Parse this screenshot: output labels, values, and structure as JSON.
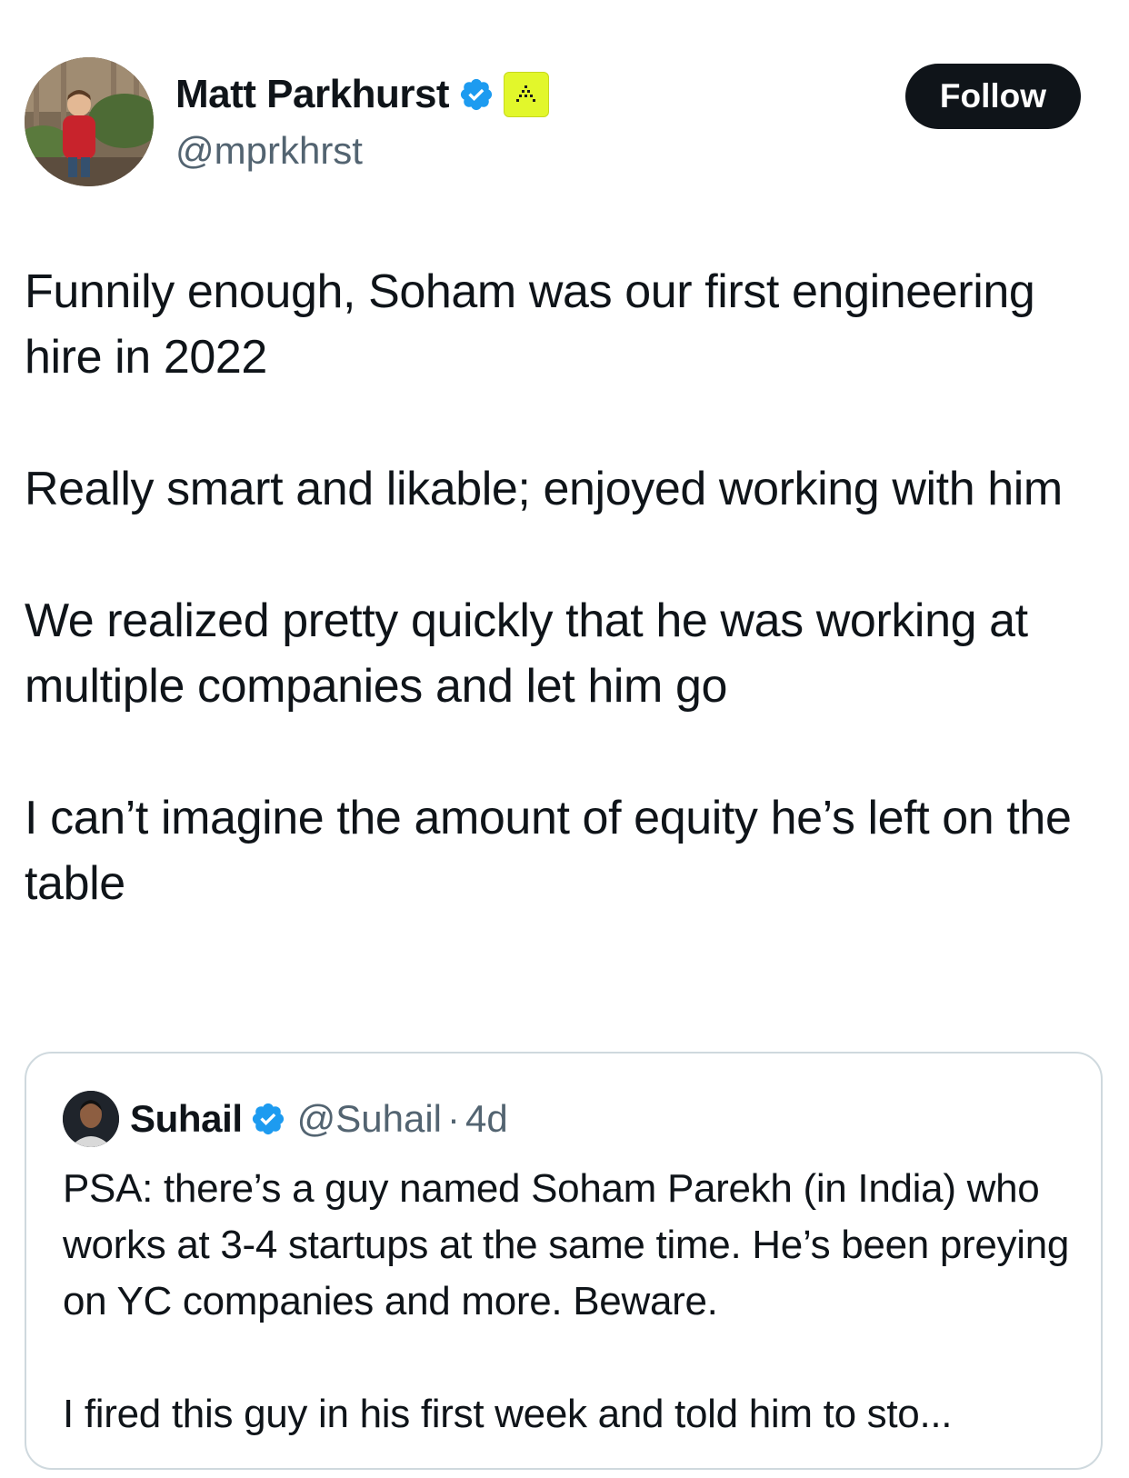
{
  "tweet": {
    "author": {
      "display_name": "Matt Parkhurst",
      "handle": "@mprkhrst",
      "verified": true,
      "affiliate_badge": "affiliate-logo-icon"
    },
    "follow_label": "Follow",
    "paragraphs": [
      "Funnily enough, Soham was our first engineering hire in 2022",
      "Really smart and likable; enjoyed working with him",
      "We realized pretty quickly that he was working at multiple companies and let him go",
      "I can’t imagine the amount of equity he’s left on the table"
    ]
  },
  "quoted": {
    "author": {
      "display_name": "Suhail",
      "handle": "@Suhail",
      "verified": true
    },
    "separator": "·",
    "time": "4d",
    "paragraphs": [
      "PSA: there’s a guy named Soham Parekh (in India) who works at 3-4 startups at the same time. He’s been preying on YC companies and more. Beware.",
      "I fired this guy in his first week and told him to sto..."
    ]
  },
  "colors": {
    "text": "#0f1419",
    "secondary_text": "#536471",
    "verified_blue": "#1d9bf0",
    "affiliate_yellow": "#e2f72b",
    "follow_bg": "#0f1419",
    "border": "#cfd9de"
  }
}
